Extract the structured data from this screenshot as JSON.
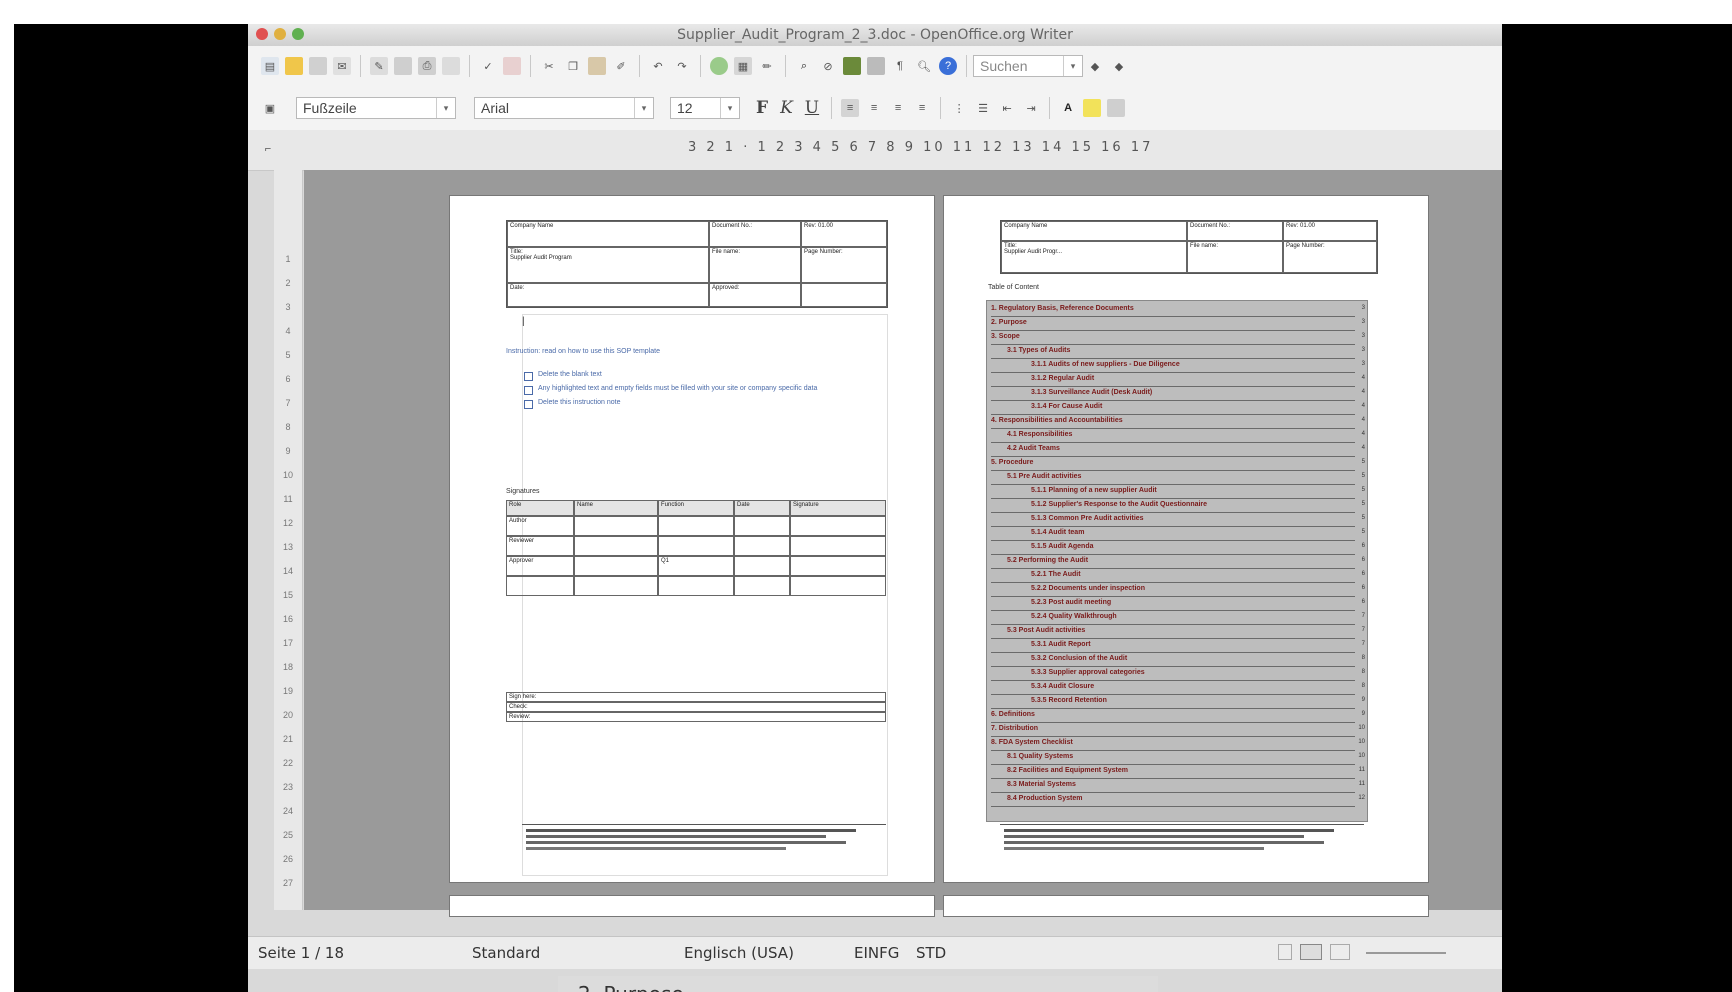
{
  "window": {
    "title": "Supplier_Audit_Program_2_3.doc - OpenOffice.org Writer"
  },
  "toolbar_standard": {
    "search_placeholder": "Suchen"
  },
  "toolbar_format": {
    "paragraph_style": "Fußzeile",
    "font_name": "Arial",
    "font_size": "12",
    "bold_label": "F",
    "italic_label": "K",
    "underline_label": "U"
  },
  "ruler": {
    "ticks": "3 2 1 · 1 2 3 4 5 6 7 8 9 10 11 12 13 14 15 16 17"
  },
  "page_left": {
    "header": {
      "company_label": "Company Name",
      "title_label": "Title:",
      "title_value": "Supplier Audit Program",
      "date_label": "Date:",
      "doc_number": "Document No.:",
      "rev": "Rev: 01.00",
      "file_name": "File name:",
      "page_number": "Page Number:",
      "approved": "Approved:"
    },
    "instruction_heading": "Instruction: read on how to use this SOP template",
    "instructions": [
      "Delete the blank text",
      "Any highlighted text and empty fields must be filled with your site or company specific data",
      "Delete this instruction note"
    ],
    "signatures_label": "Signatures",
    "sig_headers": [
      "Role",
      "Name",
      "Function",
      "Date",
      "Signature"
    ],
    "sig_rows": [
      "Author",
      "Reviewer",
      "Approver"
    ],
    "sig_function_value": "Q1",
    "sign_block": [
      "Sign here:",
      "Check:",
      "Review:"
    ]
  },
  "page_right": {
    "header": {
      "company_label": "Company Name",
      "title_label": "Title:",
      "title_value": "Supplier Audit Progr...",
      "doc_number": "Document No.:",
      "rev": "Rev: 01.00",
      "file_name": "File name:",
      "page_number": "Page Number:"
    },
    "toc_title": "Table of Content",
    "toc_entries": [
      {
        "text": "1. Regulatory Basis, Reference Documents",
        "level": 0,
        "page": "3"
      },
      {
        "text": "2. Purpose",
        "level": 0,
        "page": "3"
      },
      {
        "text": "3. Scope",
        "level": 0,
        "page": "3"
      },
      {
        "text": "3.1 Types of Audits",
        "level": 1,
        "page": "3"
      },
      {
        "text": "3.1.1 Audits of new suppliers - Due Diligence",
        "level": 2,
        "page": "3"
      },
      {
        "text": "3.1.2 Regular Audit",
        "level": 2,
        "page": "4"
      },
      {
        "text": "3.1.3 Surveillance Audit (Desk Audit)",
        "level": 2,
        "page": "4"
      },
      {
        "text": "3.1.4 For Cause Audit",
        "level": 2,
        "page": "4"
      },
      {
        "text": "4. Responsibilities and Accountabilities",
        "level": 0,
        "page": "4"
      },
      {
        "text": "4.1 Responsibilities",
        "level": 1,
        "page": "4"
      },
      {
        "text": "4.2 Audit Teams",
        "level": 1,
        "page": "4"
      },
      {
        "text": "5. Procedure",
        "level": 0,
        "page": "5"
      },
      {
        "text": "5.1 Pre Audit activities",
        "level": 1,
        "page": "5"
      },
      {
        "text": "5.1.1 Planning of a new supplier Audit",
        "level": 2,
        "page": "5"
      },
      {
        "text": "5.1.2 Supplier's Response to the Audit Questionnaire",
        "level": 2,
        "page": "5"
      },
      {
        "text": "5.1.3 Common Pre Audit activities",
        "level": 2,
        "page": "5"
      },
      {
        "text": "5.1.4 Audit team",
        "level": 2,
        "page": "5"
      },
      {
        "text": "5.1.5 Audit Agenda",
        "level": 2,
        "page": "6"
      },
      {
        "text": "5.2 Performing the Audit",
        "level": 1,
        "page": "6"
      },
      {
        "text": "5.2.1 The Audit",
        "level": 2,
        "page": "6"
      },
      {
        "text": "5.2.2 Documents under inspection",
        "level": 2,
        "page": "6"
      },
      {
        "text": "5.2.3 Post audit meeting",
        "level": 2,
        "page": "6"
      },
      {
        "text": "5.2.4 Quality Walkthrough",
        "level": 2,
        "page": "7"
      },
      {
        "text": "5.3 Post Audit activities",
        "level": 1,
        "page": "7"
      },
      {
        "text": "5.3.1 Audit Report",
        "level": 2,
        "page": "7"
      },
      {
        "text": "5.3.2 Conclusion of the Audit",
        "level": 2,
        "page": "8"
      },
      {
        "text": "5.3.3 Supplier approval categories",
        "level": 2,
        "page": "8"
      },
      {
        "text": "5.3.4 Audit Closure",
        "level": 2,
        "page": "8"
      },
      {
        "text": "5.3.5 Record Retention",
        "level": 2,
        "page": "9"
      },
      {
        "text": "6. Definitions",
        "level": 0,
        "page": "9"
      },
      {
        "text": "7. Distribution",
        "level": 0,
        "page": "10"
      },
      {
        "text": "8. FDA System Checklist",
        "level": 0,
        "page": "10"
      },
      {
        "text": "8.1 Quality Systems",
        "level": 1,
        "page": "10"
      },
      {
        "text": "8.2 Facilities and Equipment System",
        "level": 1,
        "page": "11"
      },
      {
        "text": "8.3 Material Systems",
        "level": 1,
        "page": "11"
      },
      {
        "text": "8.4 Production System",
        "level": 1,
        "page": "12"
      }
    ]
  },
  "statusbar": {
    "page": "Seite 1 / 18",
    "style": "Standard",
    "language": "Englisch (USA)",
    "insert_mode": "EINFG",
    "selection_mode": "STD"
  },
  "below_text": "2. Purpose",
  "colors": {
    "toc_background": "#bdbdbd",
    "toc_text": "#7a1a1a",
    "instruction_text": "#4a6aa8",
    "workspace": "#9a9a9a"
  }
}
